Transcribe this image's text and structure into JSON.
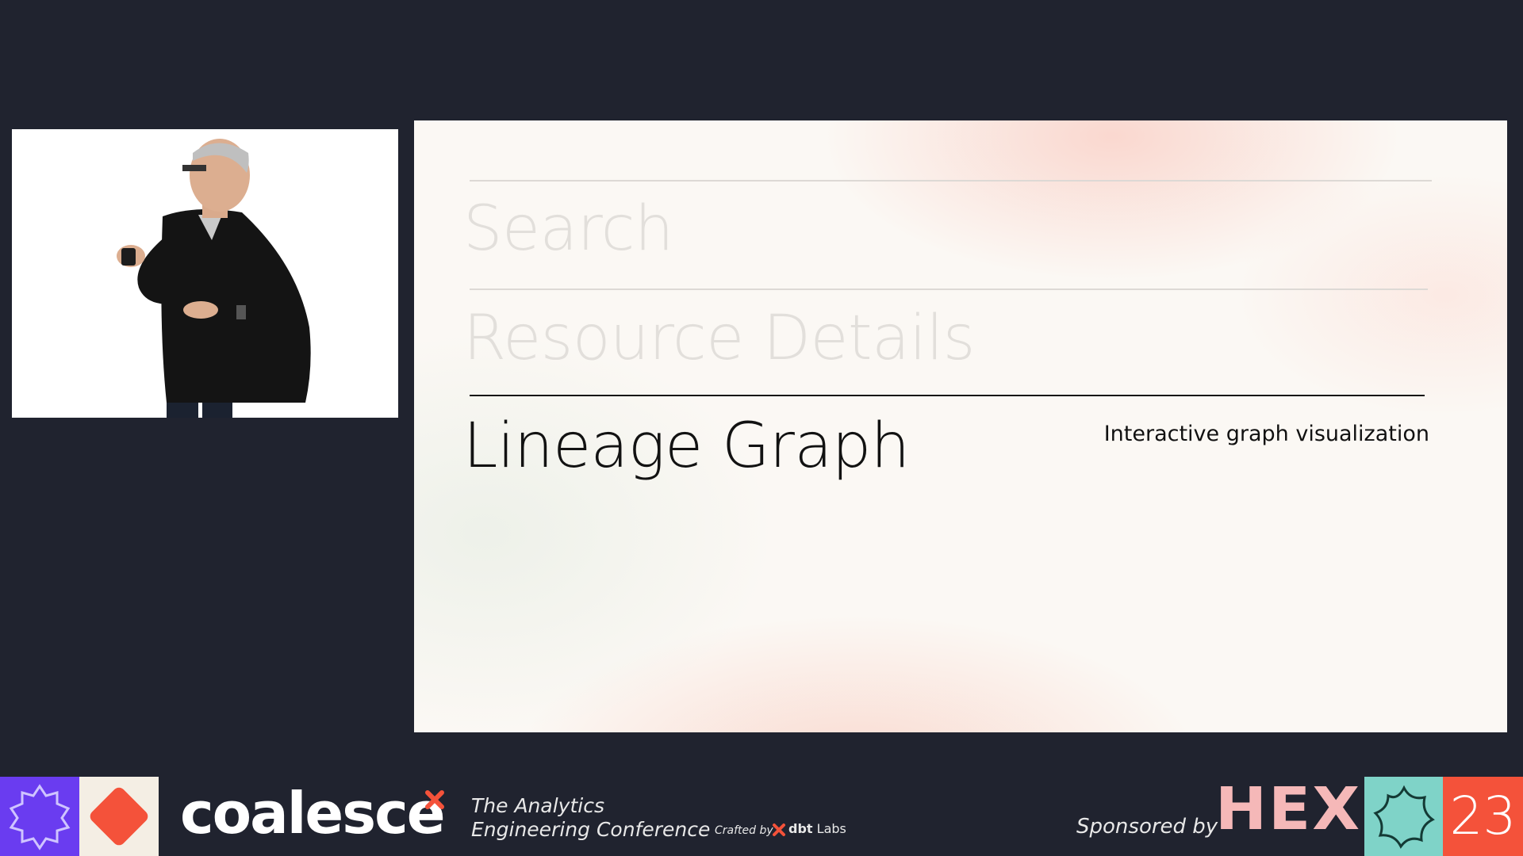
{
  "slide": {
    "items": [
      {
        "title": "Search",
        "state": "inactive"
      },
      {
        "title": "Resource Details",
        "state": "inactive"
      },
      {
        "title": "Lineage Graph",
        "state": "active",
        "description": "Interactive graph visualization"
      }
    ]
  },
  "footer": {
    "brand": "coalesce",
    "tagline_line1": "The Analytics",
    "tagline_line2": "Engineering Conference",
    "crafted_by": "Crafted by",
    "crafted_company_bold": "dbt",
    "crafted_company_rest": "Labs",
    "sponsored_by": "Sponsored by",
    "sponsor": "HEX",
    "year": "23"
  },
  "colors": {
    "background": "#20232f",
    "purple_tile": "#6a3cf0",
    "red_accent": "#f4523a",
    "cream_tile": "#f4eee4",
    "teal_tile": "#7fd3c8",
    "sponsor_pink": "#f5b8b8"
  },
  "icons": [
    "badge-star-icon",
    "diamond-icon",
    "x-mark-icon",
    "dbt-logo-icon",
    "star-outline-icon"
  ]
}
